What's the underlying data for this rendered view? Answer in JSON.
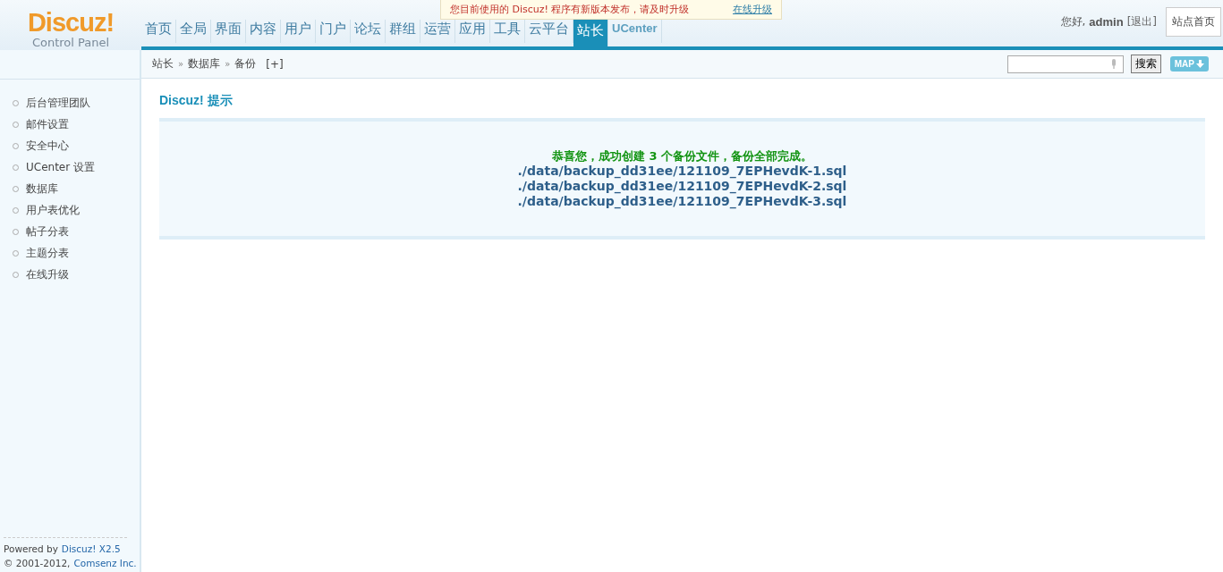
{
  "logo": {
    "title": "Discuz!",
    "subtitle": "Control Panel"
  },
  "notice": {
    "text": "您目前使用的 Discuz! 程序有新版本发布，请及时升级",
    "link": "在线升级"
  },
  "nav_tabs": [
    {
      "label": "首页",
      "selected": false,
      "kind": "zh"
    },
    {
      "label": "全局",
      "selected": false,
      "kind": "zh"
    },
    {
      "label": "界面",
      "selected": false,
      "kind": "zh"
    },
    {
      "label": "内容",
      "selected": false,
      "kind": "zh"
    },
    {
      "label": "用户",
      "selected": false,
      "kind": "zh"
    },
    {
      "label": "门户",
      "selected": false,
      "kind": "zh"
    },
    {
      "label": "论坛",
      "selected": false,
      "kind": "zh"
    },
    {
      "label": "群组",
      "selected": false,
      "kind": "zh"
    },
    {
      "label": "运营",
      "selected": false,
      "kind": "zh"
    },
    {
      "label": "应用",
      "selected": false,
      "kind": "zh"
    },
    {
      "label": "工具",
      "selected": false,
      "kind": "zh"
    },
    {
      "label": "云平台",
      "selected": false,
      "kind": "zh"
    },
    {
      "label": "站长",
      "selected": true,
      "kind": "zh"
    },
    {
      "label": "UCenter",
      "selected": false,
      "kind": "en"
    }
  ],
  "user": {
    "greeting": "您好,",
    "name": "admin",
    "logout": "[退出]",
    "home_button": "站点首页"
  },
  "breadcrumb": [
    {
      "label": "站长"
    },
    {
      "label": "数据库"
    },
    {
      "label": "备份"
    }
  ],
  "breadcrumb_separator": "»",
  "breadcrumb_add": "[+]",
  "search": {
    "button": "搜索",
    "map_button": "MAP"
  },
  "sidebar": {
    "items": [
      {
        "label": "后台管理团队"
      },
      {
        "label": "邮件设置"
      },
      {
        "label": "安全中心"
      },
      {
        "label": "UCenter 设置"
      },
      {
        "label": "数据库"
      },
      {
        "label": "用户表优化"
      },
      {
        "label": "帖子分表"
      },
      {
        "label": "主题分表"
      },
      {
        "label": "在线升级"
      }
    ]
  },
  "footer": [
    [
      {
        "text": "Powered by",
        "link": false
      },
      {
        "text": "Discuz! X2.5",
        "link": true
      }
    ],
    [
      {
        "text": "© 2001-2012,",
        "link": false
      },
      {
        "text": "Comsenz Inc.",
        "link": true
      }
    ]
  ],
  "main": {
    "title": "Discuz! 提示",
    "message": "恭喜您，成功创建 3 个备份文件，备份全部完成。",
    "files": [
      "./data/backup_dd31ee/121109_7EPHevdK-1.sql",
      "./data/backup_dd31ee/121109_7EPHevdK-2.sql",
      "./data/backup_dd31ee/121109_7EPHevdK-3.sql"
    ]
  }
}
